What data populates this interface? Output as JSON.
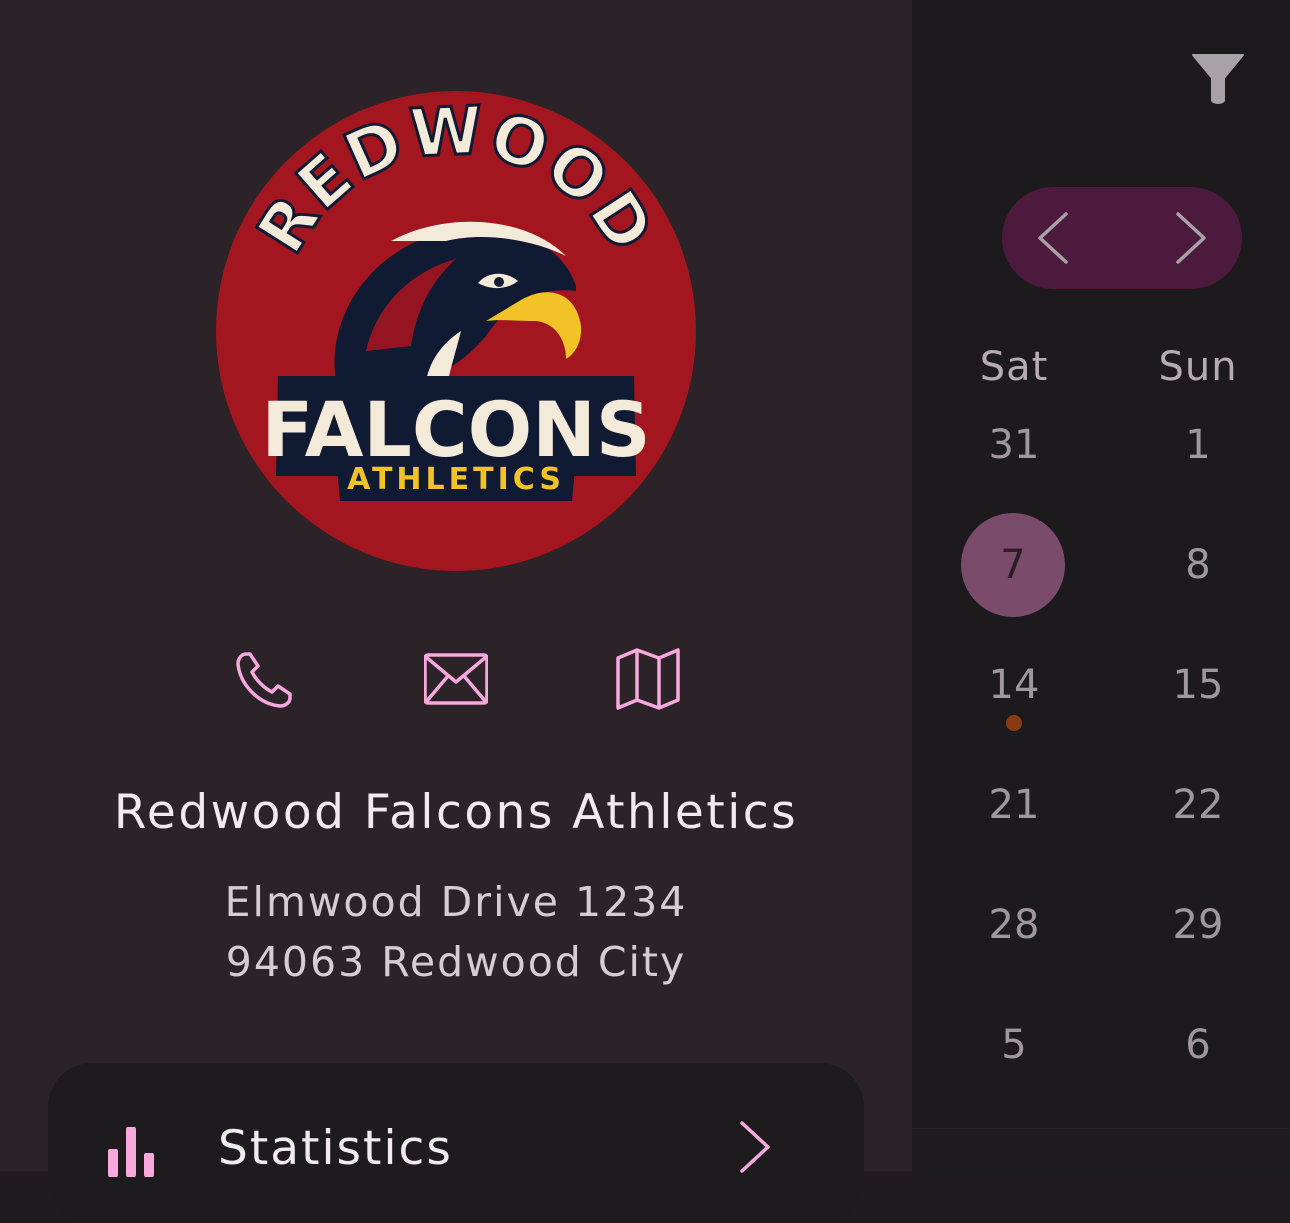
{
  "club": {
    "logo_text_top": "REDWOOD",
    "logo_text_main": "FALCONS",
    "logo_text_sub": "ATHLETICS",
    "name": "Redwood Falcons Athletics",
    "address_line1": "Elmwood Drive 1234",
    "address_line2": "94063 Redwood City"
  },
  "actions": [
    {
      "id": "phone",
      "icon": "phone-icon"
    },
    {
      "id": "email",
      "icon": "envelope-icon"
    },
    {
      "id": "map",
      "icon": "map-icon"
    }
  ],
  "stats_card": {
    "label": "Statistics",
    "icon": "bar-chart-icon"
  },
  "calendar": {
    "filter_icon": "filter-icon",
    "weekday_sat": "Sat",
    "weekday_sun": "Sun",
    "rows": [
      [
        "31",
        "1"
      ],
      [
        "7",
        "8"
      ],
      [
        "14",
        "15"
      ],
      [
        "21",
        "22"
      ],
      [
        "28",
        "29"
      ],
      [
        "5",
        "6"
      ]
    ],
    "selected_day": "7",
    "event_days": [
      "14"
    ]
  },
  "colors": {
    "accent_pink": "#f7a8dc",
    "selected_day_bg": "#7b4b6b",
    "nav_pill_bg": "#4b1a3c",
    "event_dot": "#8a3a12",
    "logo_red": "#a3151f",
    "logo_navy": "#111a33",
    "logo_gold": "#f2c226"
  }
}
